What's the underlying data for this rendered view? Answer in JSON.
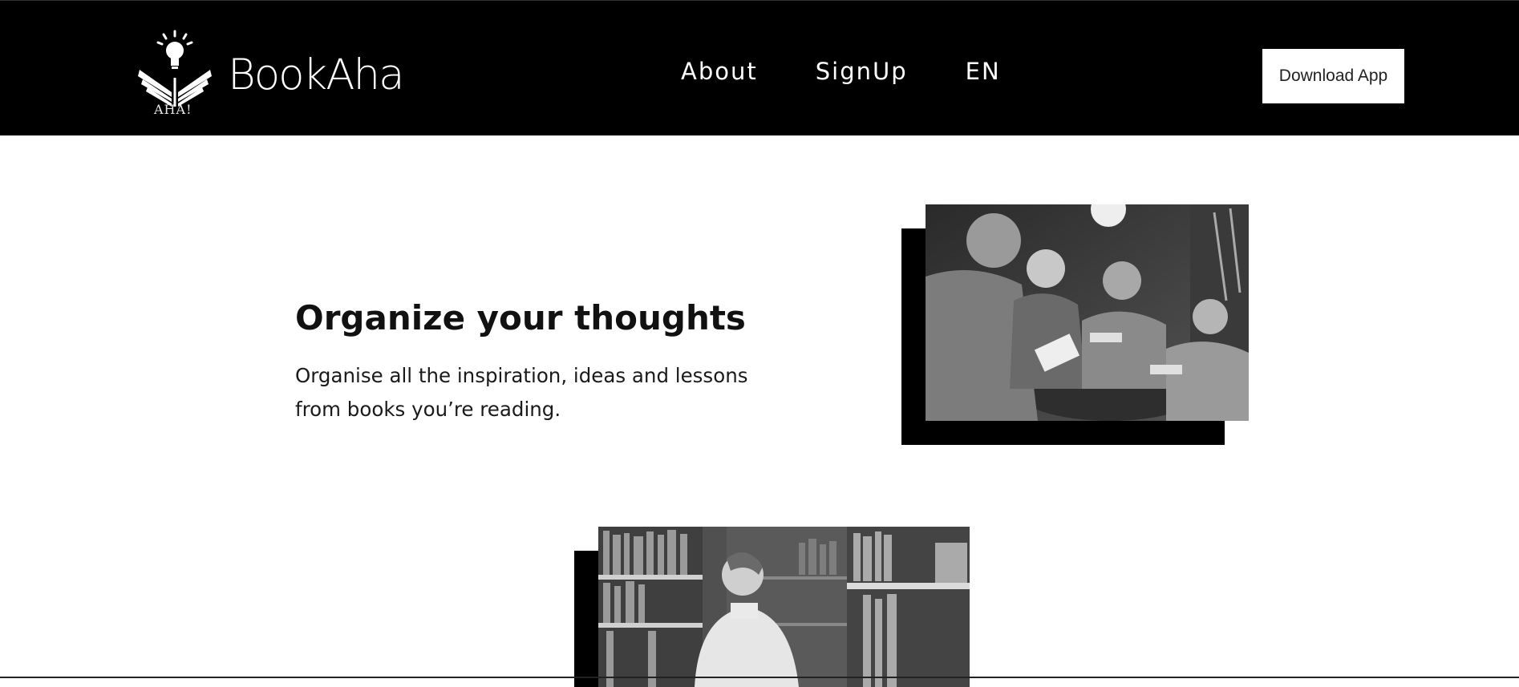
{
  "header": {
    "brand": "BookAha",
    "logo_subtext": "AHA!",
    "nav": [
      {
        "label": "About"
      },
      {
        "label": "SignUp"
      },
      {
        "label": "EN"
      }
    ],
    "download_button": "Download App"
  },
  "feature": {
    "title": "Organize your thoughts",
    "description": "Organise all the inspiration, ideas and lessons from books you’re reading."
  },
  "colors": {
    "header_bg": "#000000",
    "page_bg": "#ffffff",
    "text": "#111111"
  },
  "icons": {
    "logo": "lightbulb-book-logo"
  }
}
